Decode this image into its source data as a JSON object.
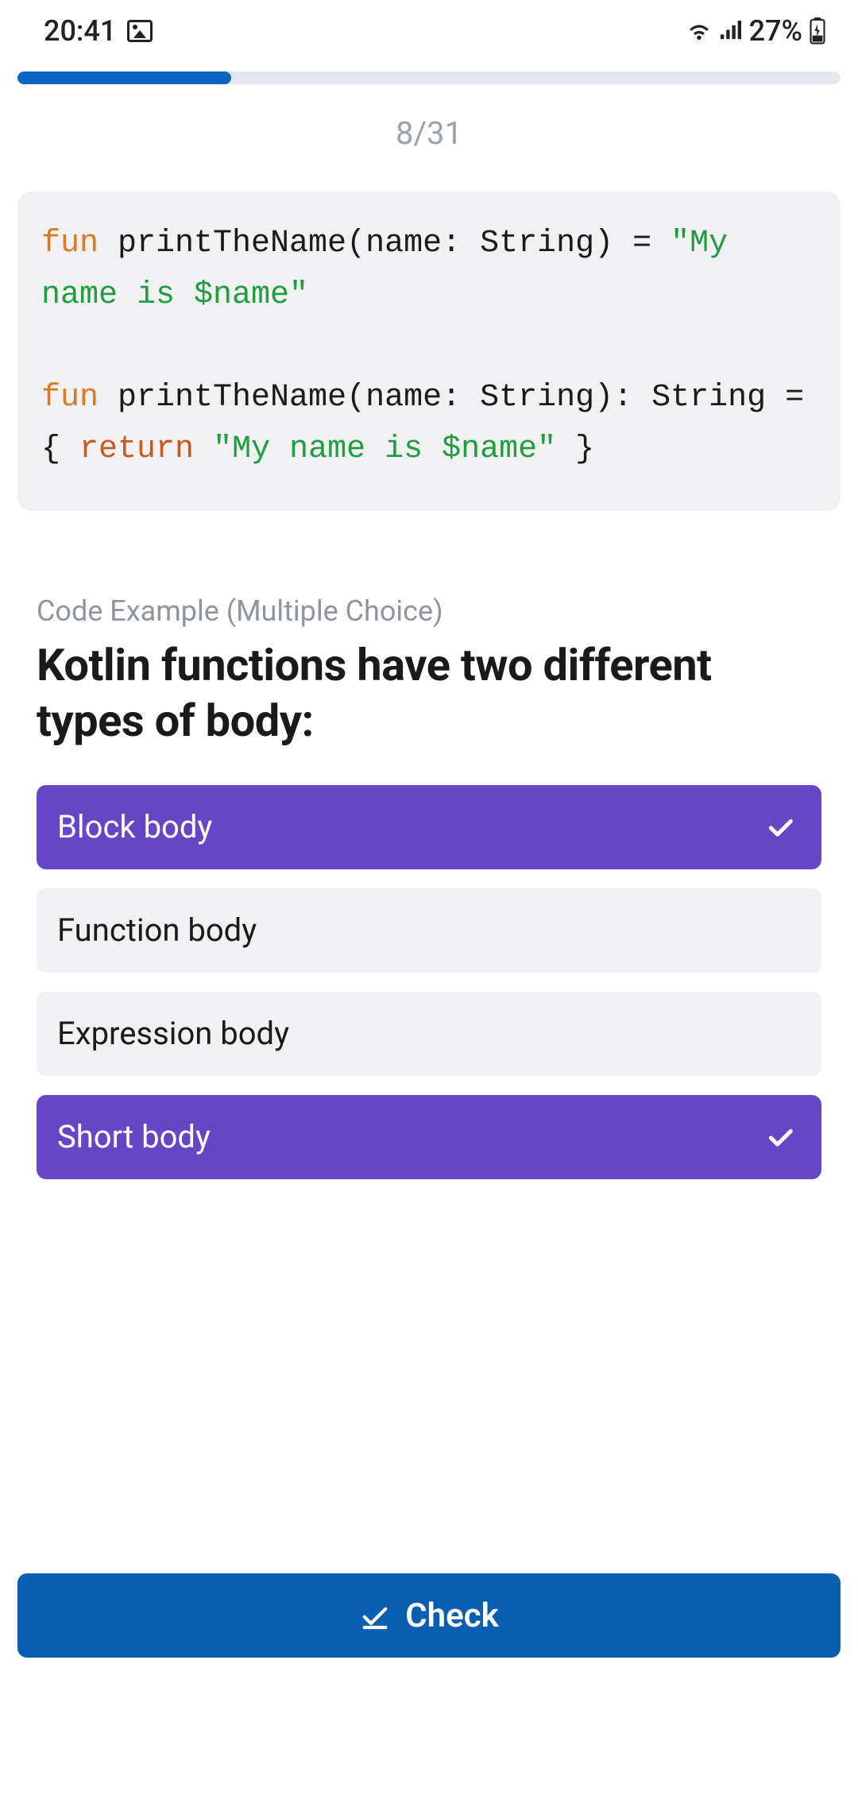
{
  "status": {
    "time": "20:41",
    "battery_pct": "27%"
  },
  "progress": {
    "current": 8,
    "total": 31,
    "label": "8/31",
    "fill_pct": 26
  },
  "code": {
    "tokens": [
      {
        "t": "fun",
        "c": "keyword"
      },
      {
        "t": " printTheName(name: String) = ",
        "c": ""
      },
      {
        "t": "\"My name is $name\"",
        "c": "string"
      },
      {
        "t": "\n\n",
        "c": ""
      },
      {
        "t": "fun",
        "c": "keyword"
      },
      {
        "t": " printTheName(name: String): String = { ",
        "c": ""
      },
      {
        "t": "return",
        "c": "return"
      },
      {
        "t": " ",
        "c": ""
      },
      {
        "t": "\"My name is $name\"",
        "c": "string"
      },
      {
        "t": " }",
        "c": ""
      }
    ]
  },
  "question": {
    "section_label": "Code Example (Multiple Choice)",
    "text": "Kotlin functions have two different types of body:"
  },
  "options": [
    {
      "label": "Block body",
      "selected": true
    },
    {
      "label": "Function body",
      "selected": false
    },
    {
      "label": "Expression body",
      "selected": false
    },
    {
      "label": "Short body",
      "selected": true
    }
  ],
  "check_button": {
    "label": "Check"
  },
  "colors": {
    "accent_purple": "#6646c6",
    "accent_blue": "#0a5fb5",
    "progress_blue": "#0a66c2",
    "surface_grey": "#f1f1f3"
  }
}
